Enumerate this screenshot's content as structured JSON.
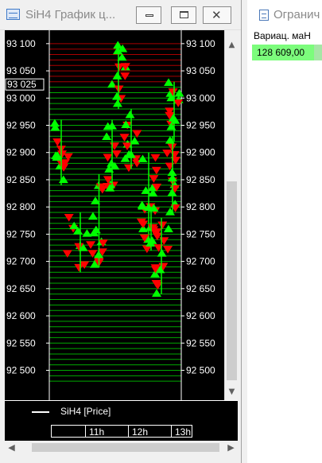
{
  "chart_window": {
    "title": "SiH4 График ц...",
    "controls": {
      "minimize": "minimize",
      "maximize": "maximize",
      "close": "close"
    }
  },
  "chart_data": {
    "type": "line",
    "series": [
      {
        "name": "SiH4 [Price]"
      }
    ],
    "y_ticks": [
      93100,
      93050,
      93000,
      92950,
      92900,
      92850,
      92800,
      92750,
      92700,
      92650,
      92600,
      92550,
      92500
    ],
    "y_tick_labels": [
      "93 100",
      "93 050",
      "93 000",
      "92 950",
      "92 900",
      "92 850",
      "92 800",
      "92 750",
      "92 700",
      "92 650",
      "92 600",
      "92 550",
      "92 500"
    ],
    "current_price": 93025,
    "current_price_label": "93 025",
    "ylim": [
      92470,
      93110
    ],
    "x_labels": [
      "11h",
      "12h",
      "13h"
    ],
    "grid": true,
    "colors": {
      "background": "#000000",
      "buy": "#00ff00",
      "sell": "#ff0000",
      "grid_below": "#00c800",
      "grid_above": "#c80000",
      "axis": "#ffffff"
    }
  },
  "legend": {
    "label": "SiH4 [Price]"
  },
  "right_window": {
    "title": "Огранич",
    "column_header": "Вариац. маН",
    "value": "128 609,00"
  },
  "icons": {
    "vscroll_up": "▲",
    "vscroll_down": "▼",
    "hscroll_left": "◀",
    "hscroll_right": "▶",
    "close_glyph": "✕"
  }
}
